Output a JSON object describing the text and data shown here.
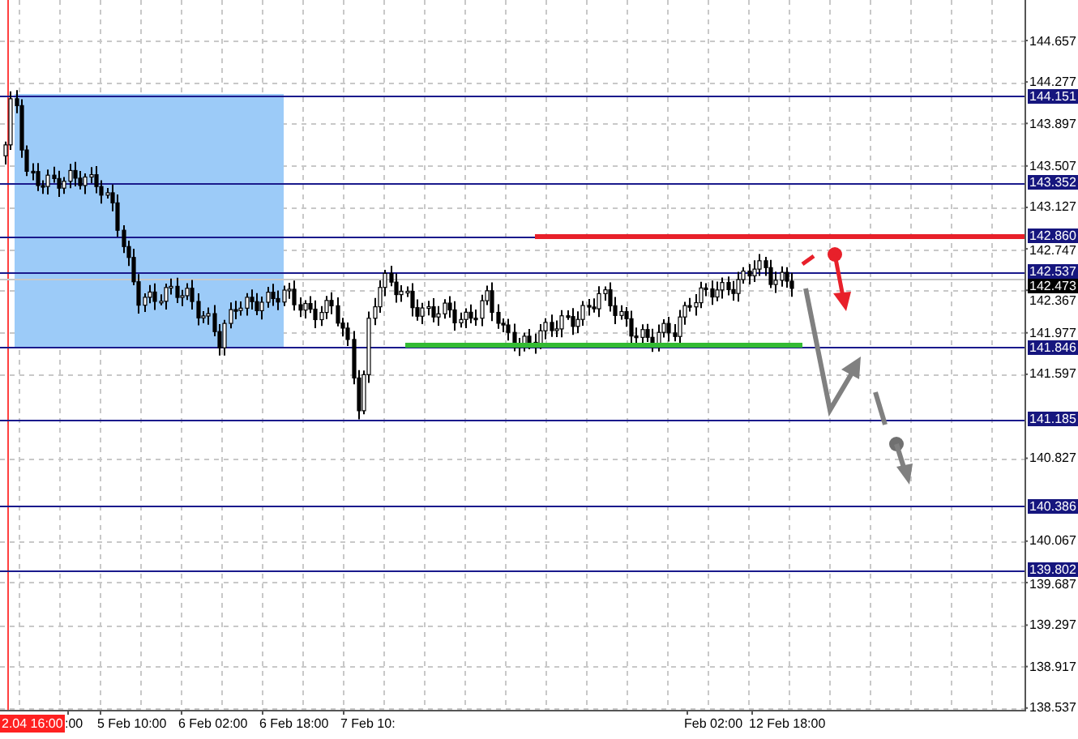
{
  "price_axis": {
    "ticks": [
      "144.657",
      "144.277",
      "143.897",
      "143.507",
      "143.127",
      "142.747",
      "142.367",
      "141.977",
      "141.597",
      "140.827",
      "140.067",
      "139.687",
      "139.297",
      "138.917",
      "138.537"
    ]
  },
  "levels": [
    {
      "price": "144.151"
    },
    {
      "price": "143.352"
    },
    {
      "price": "142.860"
    },
    {
      "price": "142.537"
    },
    {
      "price": "141.846"
    },
    {
      "price": "141.185"
    },
    {
      "price": "140.386"
    },
    {
      "price": "139.802"
    }
  ],
  "current_price": "142.473",
  "time_axis": {
    "labels": [
      {
        "text": "2.04 16:00",
        "kind": "cursor"
      },
      {
        "text": ":00",
        "kind": "tick"
      },
      {
        "text": "5 Feb 10:00",
        "kind": "tick"
      },
      {
        "text": "6 Feb 02:00",
        "kind": "tick"
      },
      {
        "text": "6 Feb 18:00",
        "kind": "tick"
      },
      {
        "text": "7 Feb 10:",
        "kind": "tick"
      },
      {
        "text": "Feb 02:00",
        "kind": "tick"
      },
      {
        "text": "12 Feb 18:00",
        "kind": "tick"
      }
    ]
  }
}
